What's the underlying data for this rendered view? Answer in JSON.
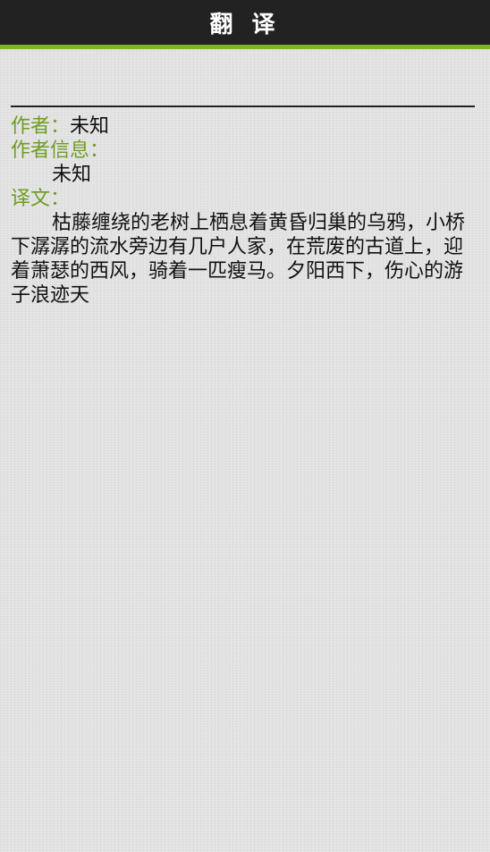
{
  "header": {
    "title": "翻 译"
  },
  "colors": {
    "header_bg": "#222222",
    "accent": "#7fb32b",
    "label": "#6f9d23",
    "text": "#111111"
  },
  "content": {
    "author_label": "作者：",
    "author_value": "未知",
    "author_info_label": "作者信息：",
    "author_info_value": "未知",
    "translation_label": "译文：",
    "translation_text": "枯藤缠绕的老树上栖息着黄昏归巢的乌鸦，小桥下潺潺的流水旁边有几户人家，在荒废的古道上，迎着萧瑟的西风，骑着一匹瘦马。夕阳西下，伤心的游子浪迹天"
  }
}
